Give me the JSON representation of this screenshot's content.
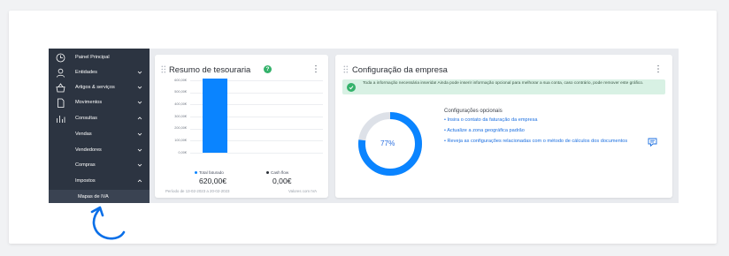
{
  "sidebar": {
    "items": [
      {
        "label": "Painel Principal",
        "icon": "clock-icon",
        "chevron": ""
      },
      {
        "label": "Entidades",
        "icon": "user-icon",
        "chevron": "down"
      },
      {
        "label": "Artigos & serviços",
        "icon": "basket-icon",
        "chevron": "down"
      },
      {
        "label": "Movimentos",
        "icon": "document-icon",
        "chevron": "down"
      },
      {
        "label": "Consultas",
        "icon": "bar-chart-icon",
        "chevron": "up"
      },
      {
        "label": "Vendas",
        "icon": "",
        "chevron": "down"
      },
      {
        "label": "Vendedores",
        "icon": "",
        "chevron": "down"
      },
      {
        "label": "Compras",
        "icon": "",
        "chevron": "down"
      },
      {
        "label": "Impostos",
        "icon": "",
        "chevron": "up"
      }
    ],
    "subitem": "Mapas de IVA"
  },
  "treasury": {
    "title": "Resumo de tesouraria",
    "help": "?",
    "legend": [
      {
        "label": "Total faturado",
        "value": "620,00€",
        "color": "#0a84ff"
      },
      {
        "label": "Cash flow",
        "value": "0,00€",
        "color": "#2b2f36"
      }
    ],
    "period": "Período de 13-02-2023 a 20-02-2023",
    "note": "Valores com IVA"
  },
  "chart_data": {
    "type": "bar",
    "categories": [
      "Total faturado"
    ],
    "series": [
      {
        "name": "Total faturado",
        "values": [
          620
        ]
      }
    ],
    "yticks": [
      "600,00€",
      "500,00€",
      "400,00€",
      "300,00€",
      "200,00€",
      "100,00€",
      "0,00€"
    ],
    "ylim": [
      0,
      600
    ],
    "grid": true
  },
  "config": {
    "title": "Configuração da empresa",
    "alert": "Toda a informação necessária inserida! Ainda pode inserir informação opcional para melhorar a sua conta, caso contrário, pode remover este gráfico.",
    "optional_title": "Configurações opcionais",
    "links": [
      "• Insira o contato da faturação da empresa",
      "• Actualize a zona geográfica padrão",
      "• Reveja as configurações relacionadas com o método de cálculos dos documentos"
    ],
    "progress": 0.77,
    "progress_label": "77%",
    "colors": {
      "progress": "#0a84ff",
      "track": "#dde1e8"
    }
  }
}
